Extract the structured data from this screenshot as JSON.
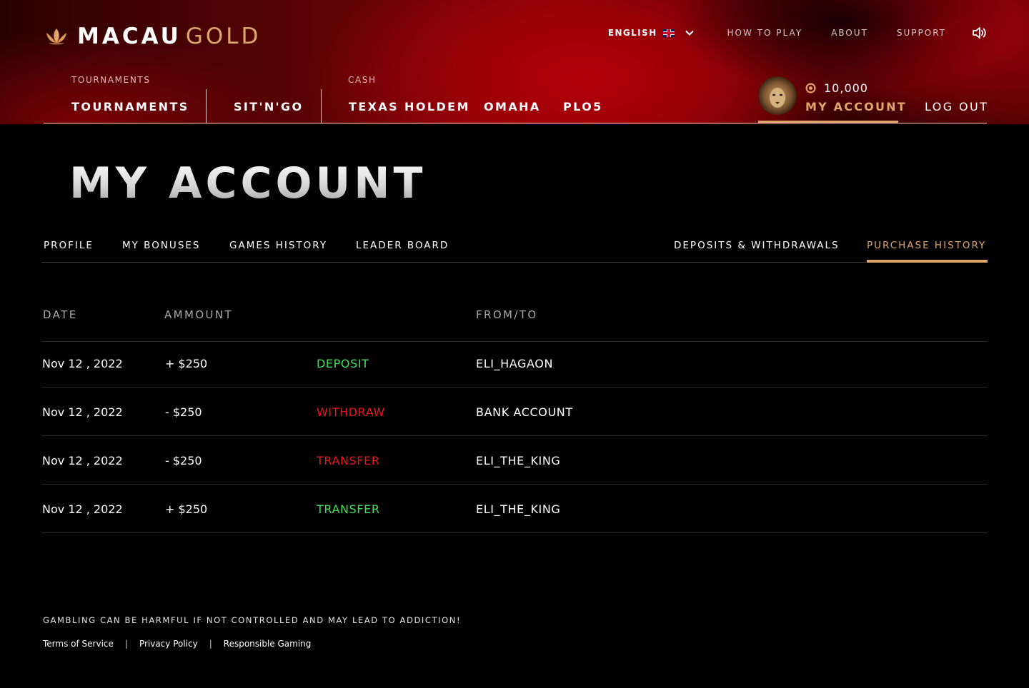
{
  "brand": {
    "name_primary": "MACAU",
    "name_secondary": "GOLD"
  },
  "top_nav": {
    "language": "ENGLISH",
    "links": [
      "HOW TO PLAY",
      "ABOUT",
      "SUPPORT"
    ]
  },
  "game_nav": {
    "categories": [
      "TOURNAMENTS",
      "CASH"
    ],
    "tabs": [
      "TOURNAMENTS",
      "SIT'N'GO",
      "TEXAS HOLDEM",
      "OMAHA",
      "PLO5"
    ]
  },
  "account": {
    "balance": "10,000",
    "my_account_label": "MY ACCOUNT",
    "logout_label": "LOG OUT"
  },
  "page": {
    "title": "MY ACCOUNT",
    "tabs": [
      "PROFILE",
      "MY BONUSES",
      "GAMES HISTORY",
      "LEADER BOARD",
      "DEPOSITS & WITHDRAWALS",
      "PURCHASE HISTORY"
    ],
    "active_tab": "PURCHASE HISTORY"
  },
  "table": {
    "headers": [
      "DATE",
      "AMMOUNT",
      "FROM/TO"
    ],
    "rows": [
      {
        "date": "Nov 12 , 2022",
        "amount": "+ $250",
        "type": "DEPOSIT",
        "type_color": "#3ee05a",
        "party": "ELI_HAGAON"
      },
      {
        "date": "Nov 12 , 2022",
        "amount": "- $250",
        "type": "WITHDRAW",
        "type_color": "#e8151b",
        "party": "BANK ACCOUNT"
      },
      {
        "date": "Nov 12 , 2022",
        "amount": "- $250",
        "type": "TRANSFER",
        "type_color": "#e8151b",
        "party": "ELI_THE_KING"
      },
      {
        "date": "Nov 12 , 2022",
        "amount": "+ $250",
        "type": "TRANSFER",
        "type_color": "#3ee05a",
        "party": "ELI_THE_KING"
      }
    ]
  },
  "footer": {
    "warning": "GAMBLING CAN BE HARMFUL IF NOT CONTROLLED AND MAY LEAD TO ADDICTION!",
    "links": [
      "Terms of Service",
      "Privacy Policy",
      "Responsible Gaming"
    ]
  },
  "colors": {
    "accent": "#e0a466",
    "positive": "#3ee05a",
    "negative": "#e8151b"
  }
}
